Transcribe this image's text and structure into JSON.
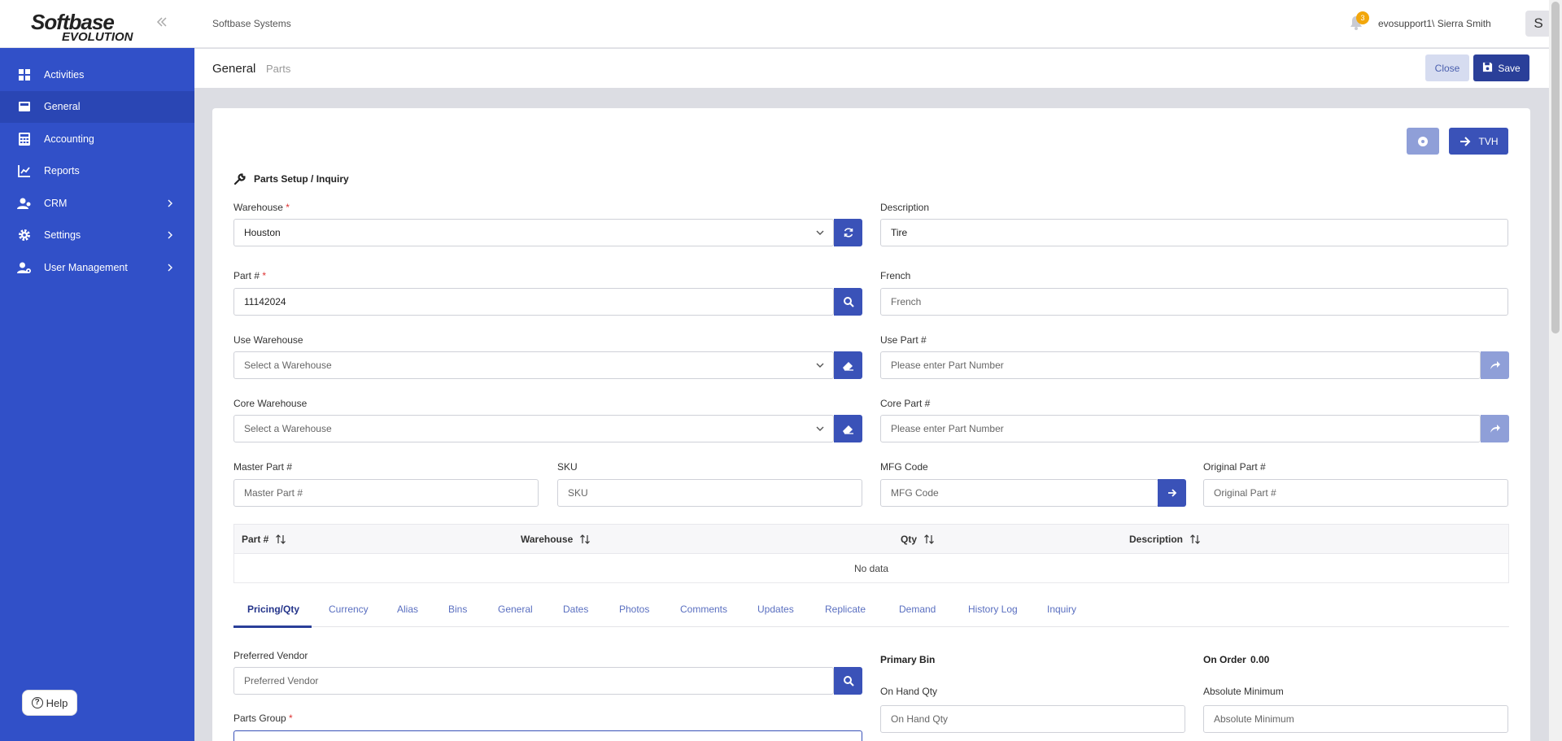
{
  "app": {
    "logo_line1": "Softbase",
    "logo_line2": "EVOLUTION",
    "company": "Softbase Systems",
    "notification_count": "3",
    "user": "evosupport1\\ Sierra Smith",
    "avatar_initial": "S"
  },
  "sidebar": {
    "items": [
      {
        "label": "Activities",
        "icon": "dashboard-icon"
      },
      {
        "label": "General",
        "icon": "inbox-icon"
      },
      {
        "label": "Accounting",
        "icon": "calculator-icon"
      },
      {
        "label": "Reports",
        "icon": "chart-line-icon"
      },
      {
        "label": "CRM",
        "icon": "users-icon"
      },
      {
        "label": "Settings",
        "icon": "gear-icon"
      },
      {
        "label": "User Management",
        "icon": "user-cog-icon"
      }
    ],
    "help_label": "Help"
  },
  "header": {
    "title": "General",
    "subtitle": "Parts",
    "close_label": "Close",
    "save_label": "Save"
  },
  "card": {
    "tvh_label": "TVH",
    "section_title": "Parts Setup / Inquiry",
    "fields": {
      "warehouse": {
        "label": "Warehouse",
        "value": "Houston"
      },
      "description": {
        "label": "Description",
        "value": "Tire"
      },
      "part_no": {
        "label": "Part #",
        "value": "11142024"
      },
      "french": {
        "label": "French",
        "placeholder": "French"
      },
      "use_warehouse": {
        "label": "Use Warehouse",
        "placeholder": "Select a Warehouse"
      },
      "use_part": {
        "label": "Use Part #",
        "placeholder": "Please enter Part Number"
      },
      "core_warehouse": {
        "label": "Core Warehouse",
        "placeholder": "Select a Warehouse"
      },
      "core_part": {
        "label": "Core Part #",
        "placeholder": "Please enter Part Number"
      },
      "master_part": {
        "label": "Master Part #",
        "placeholder": "Master Part #"
      },
      "sku": {
        "label": "SKU",
        "placeholder": "SKU"
      },
      "mfg_code": {
        "label": "MFG Code",
        "placeholder": "MFG Code"
      },
      "original_part": {
        "label": "Original Part #",
        "placeholder": "Original Part #"
      }
    },
    "grid": {
      "columns": [
        "Part #",
        "Warehouse",
        "Qty",
        "Description"
      ],
      "empty_text": "No data"
    },
    "tabs": [
      "Pricing/Qty",
      "Currency",
      "Alias",
      "Bins",
      "General",
      "Dates",
      "Photos",
      "Comments",
      "Updates",
      "Replicate",
      "Demand",
      "History Log",
      "Inquiry"
    ],
    "pricing": {
      "preferred_vendor_label": "Preferred Vendor",
      "preferred_vendor_placeholder": "Preferred Vendor",
      "parts_group_label": "Parts Group",
      "primary_bin_label": "Primary Bin",
      "on_order_label": "On Order",
      "on_order_value": "0.00",
      "on_hand_label": "On Hand Qty",
      "on_hand_placeholder": "On Hand Qty",
      "abs_min_label": "Absolute Minimum",
      "abs_min_placeholder": "Absolute Minimum"
    }
  }
}
